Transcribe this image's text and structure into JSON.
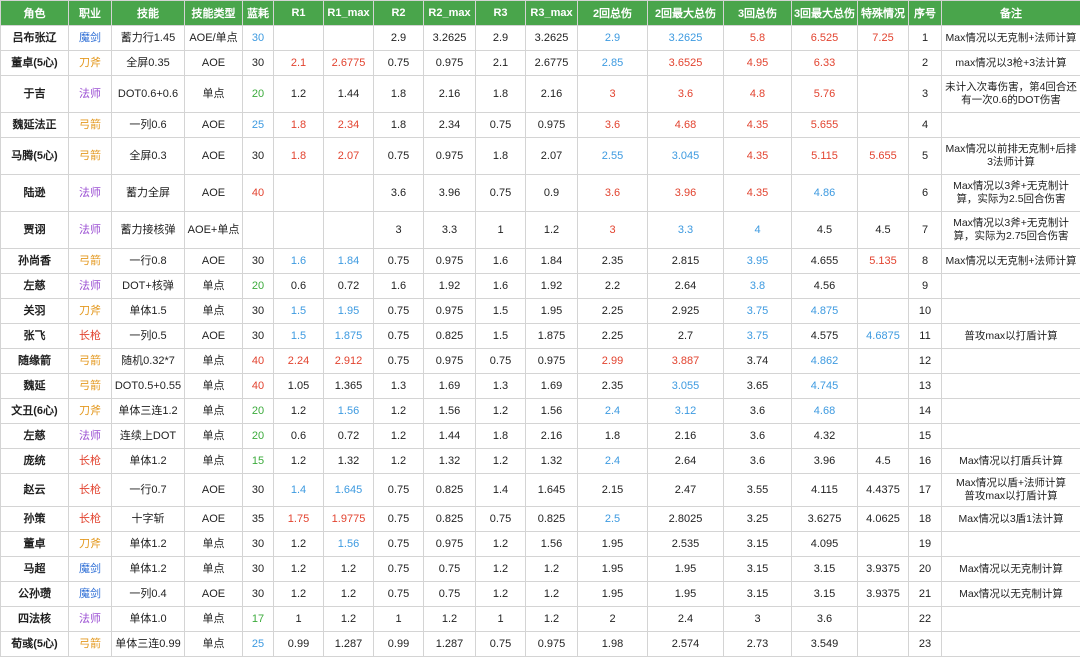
{
  "colors": {
    "header_bg": "#49a54b",
    "header_text": "#ffffff",
    "red": "#e2432f",
    "blue": "#3d9ae0",
    "green": "#3cab3c",
    "purple": "#9b4fd3",
    "orange": "#e49a22",
    "mo_jian": "#2f6fd6",
    "dao_fu": "#e49a22",
    "chang_qiang": "#e2432f"
  },
  "columns": [
    "角色",
    "职业",
    "技能",
    "技能类型",
    "蓝耗",
    "R1",
    "R1_max",
    "R2",
    "R2_max",
    "R3",
    "R3_max",
    "2回总伤",
    "2回最大总伤",
    "3回总伤",
    "3回最大总伤",
    "特殊情况",
    "序号",
    "备注"
  ],
  "rows": [
    {
      "name": "吕布张辽",
      "job": "魔剑",
      "skill": "蓄力行1.45",
      "type": "AOE/单点",
      "mana": "30",
      "manaColor": "blue",
      "r1": "",
      "r1c": "",
      "r1m": "",
      "r1mc": "",
      "r2": "2.9",
      "r2m": "3.2625",
      "r3": "2.9",
      "r3m": "3.2625",
      "t2": "2.9",
      "t2c": "blue",
      "t2m": "3.2625",
      "t2mc": "blue",
      "t3": "5.8",
      "t3c": "red",
      "t3m": "6.525",
      "t3mc": "red",
      "sp": "7.25",
      "spc": "red",
      "idx": "1",
      "note": "Max情况以无克制+法师计算"
    },
    {
      "name": "董卓(5心)",
      "job": "刀斧",
      "skill": "全屏0.35",
      "type": "AOE",
      "mana": "30",
      "manaColor": "",
      "r1": "2.1",
      "r1c": "red",
      "r1m": "2.6775",
      "r1mc": "red",
      "r2": "0.75",
      "r2m": "0.975",
      "r3": "2.1",
      "r3m": "2.6775",
      "t2": "2.85",
      "t2c": "blue",
      "t2m": "3.6525",
      "t2mc": "red",
      "t3": "4.95",
      "t3c": "red",
      "t3m": "6.33",
      "t3mc": "red",
      "sp": "",
      "spc": "",
      "idx": "2",
      "note": "max情况以3枪+3法计算"
    },
    {
      "name": "于吉",
      "job": "法师",
      "skill": "DOT0.6+0.6",
      "type": "单点",
      "mana": "20",
      "manaColor": "green",
      "r1": "1.2",
      "r1c": "",
      "r1m": "1.44",
      "r1mc": "",
      "r2": "1.8",
      "r2m": "2.16",
      "r3": "1.8",
      "r3m": "2.16",
      "t2": "3",
      "t2c": "red",
      "t2m": "3.6",
      "t2mc": "red",
      "t3": "4.8",
      "t3c": "red",
      "t3m": "5.76",
      "t3mc": "red",
      "sp": "",
      "spc": "",
      "idx": "3",
      "note": "未计入次毒伤害，第4回合还有一次0.6的DOT伤害"
    },
    {
      "name": "魏延法正",
      "job": "弓箭",
      "skill": "一列0.6",
      "type": "AOE",
      "mana": "25",
      "manaColor": "blue",
      "r1": "1.8",
      "r1c": "red",
      "r1m": "2.34",
      "r1mc": "red",
      "r2": "1.8",
      "r2m": "2.34",
      "r3": "0.75",
      "r3m": "0.975",
      "t2": "3.6",
      "t2c": "red",
      "t2m": "4.68",
      "t2mc": "red",
      "t3": "4.35",
      "t3c": "red",
      "t3m": "5.655",
      "t3mc": "red",
      "sp": "",
      "spc": "",
      "idx": "4",
      "note": ""
    },
    {
      "name": "马腾(5心)",
      "job": "弓箭",
      "skill": "全屏0.3",
      "type": "AOE",
      "mana": "30",
      "manaColor": "",
      "r1": "1.8",
      "r1c": "red",
      "r1m": "2.07",
      "r1mc": "red",
      "r2": "0.75",
      "r2m": "0.975",
      "r3": "1.8",
      "r3m": "2.07",
      "t2": "2.55",
      "t2c": "blue",
      "t2m": "3.045",
      "t2mc": "blue",
      "t3": "4.35",
      "t3c": "red",
      "t3m": "5.115",
      "t3mc": "red",
      "sp": "5.655",
      "spc": "red",
      "idx": "5",
      "note": "Max情况以前排无克制+后排3法师计算"
    },
    {
      "name": "陆逊",
      "job": "法师",
      "skill": "蓄力全屏",
      "type": "AOE",
      "mana": "40",
      "manaColor": "red",
      "r1": "",
      "r1c": "",
      "r1m": "",
      "r1mc": "",
      "r2": "3.6",
      "r2m": "3.96",
      "r3": "0.75",
      "r3m": "0.9",
      "t2": "3.6",
      "t2c": "red",
      "t2m": "3.96",
      "t2mc": "red",
      "t3": "4.35",
      "t3c": "red",
      "t3m": "4.86",
      "t3mc": "blue",
      "sp": "",
      "spc": "",
      "idx": "6",
      "note": "Max情况以3斧+无克制计算，实际为2.5回合伤害"
    },
    {
      "name": "贾诩",
      "job": "法师",
      "skill": "蓄力接核弹",
      "type": "AOE+单点",
      "mana": "",
      "manaColor": "",
      "r1": "",
      "r1c": "",
      "r1m": "",
      "r1mc": "",
      "r2": "3",
      "r2m": "3.3",
      "r3": "1",
      "r3m": "1.2",
      "t2": "3",
      "t2c": "red",
      "t2m": "3.3",
      "t2mc": "blue",
      "t3": "4",
      "t3c": "blue",
      "t3m": "4.5",
      "t3mc": "",
      "sp": "4.5",
      "spc": "",
      "idx": "7",
      "note": "Max情况以3斧+无克制计算，实际为2.75回合伤害"
    },
    {
      "name": "孙尚香",
      "job": "弓箭",
      "skill": "一行0.8",
      "type": "AOE",
      "mana": "30",
      "manaColor": "",
      "r1": "1.6",
      "r1c": "blue",
      "r1m": "1.84",
      "r1mc": "blue",
      "r2": "0.75",
      "r2m": "0.975",
      "r3": "1.6",
      "r3m": "1.84",
      "t2": "2.35",
      "t2c": "",
      "t2m": "2.815",
      "t2mc": "",
      "t3": "3.95",
      "t3c": "blue",
      "t3m": "4.655",
      "t3mc": "",
      "sp": "5.135",
      "spc": "red",
      "idx": "8",
      "note": "Max情况以无克制+法师计算"
    },
    {
      "name": "左慈",
      "job": "法师",
      "skill": "DOT+核弹",
      "type": "单点",
      "mana": "20",
      "manaColor": "green",
      "r1": "0.6",
      "r1c": "",
      "r1m": "0.72",
      "r1mc": "",
      "r2": "1.6",
      "r2m": "1.92",
      "r3": "1.6",
      "r3m": "1.92",
      "t2": "2.2",
      "t2c": "",
      "t2m": "2.64",
      "t2mc": "",
      "t3": "3.8",
      "t3c": "blue",
      "t3m": "4.56",
      "t3mc": "",
      "sp": "",
      "spc": "",
      "idx": "9",
      "note": ""
    },
    {
      "name": "关羽",
      "job": "刀斧",
      "skill": "单体1.5",
      "type": "单点",
      "mana": "30",
      "manaColor": "",
      "r1": "1.5",
      "r1c": "blue",
      "r1m": "1.95",
      "r1mc": "blue",
      "r2": "0.75",
      "r2m": "0.975",
      "r3": "1.5",
      "r3m": "1.95",
      "t2": "2.25",
      "t2c": "",
      "t2m": "2.925",
      "t2mc": "",
      "t3": "3.75",
      "t3c": "blue",
      "t3m": "4.875",
      "t3mc": "blue",
      "sp": "",
      "spc": "",
      "idx": "10",
      "note": ""
    },
    {
      "name": "张飞",
      "job": "长枪",
      "skill": "一列0.5",
      "type": "AOE",
      "mana": "30",
      "manaColor": "",
      "r1": "1.5",
      "r1c": "blue",
      "r1m": "1.875",
      "r1mc": "blue",
      "r2": "0.75",
      "r2m": "0.825",
      "r3": "1.5",
      "r3m": "1.875",
      "t2": "2.25",
      "t2c": "",
      "t2m": "2.7",
      "t2mc": "",
      "t3": "3.75",
      "t3c": "blue",
      "t3m": "4.575",
      "t3mc": "",
      "sp": "4.6875",
      "spc": "blue",
      "idx": "11",
      "note": "普攻max以打盾计算"
    },
    {
      "name": "随缘箭",
      "job": "弓箭",
      "skill": "随机0.32*7",
      "type": "单点",
      "mana": "40",
      "manaColor": "red",
      "r1": "2.24",
      "r1c": "red",
      "r1m": "2.912",
      "r1mc": "red",
      "r2": "0.75",
      "r2m": "0.975",
      "r3": "0.75",
      "r3m": "0.975",
      "t2": "2.99",
      "t2c": "red",
      "t2m": "3.887",
      "t2mc": "red",
      "t3": "3.74",
      "t3c": "",
      "t3m": "4.862",
      "t3mc": "blue",
      "sp": "",
      "spc": "",
      "idx": "12",
      "note": ""
    },
    {
      "name": "魏延",
      "job": "弓箭",
      "skill": "DOT0.5+0.55",
      "type": "单点",
      "mana": "40",
      "manaColor": "red",
      "r1": "1.05",
      "r1c": "",
      "r1m": "1.365",
      "r1mc": "",
      "r2": "1.3",
      "r2m": "1.69",
      "r3": "1.3",
      "r3m": "1.69",
      "t2": "2.35",
      "t2c": "",
      "t2m": "3.055",
      "t2mc": "blue",
      "t3": "3.65",
      "t3c": "",
      "t3m": "4.745",
      "t3mc": "blue",
      "sp": "",
      "spc": "",
      "idx": "13",
      "note": ""
    },
    {
      "name": "文丑(6心)",
      "job": "刀斧",
      "skill": "单体三连1.2",
      "type": "单点",
      "mana": "20",
      "manaColor": "green",
      "r1": "1.2",
      "r1c": "",
      "r1m": "1.56",
      "r1mc": "blue",
      "r2": "1.2",
      "r2m": "1.56",
      "r3": "1.2",
      "r3m": "1.56",
      "t2": "2.4",
      "t2c": "blue",
      "t2m": "3.12",
      "t2mc": "blue",
      "t3": "3.6",
      "t3c": "",
      "t3m": "4.68",
      "t3mc": "blue",
      "sp": "",
      "spc": "",
      "idx": "14",
      "note": ""
    },
    {
      "name": "左慈",
      "job": "法师",
      "skill": "连续上DOT",
      "type": "单点",
      "mana": "20",
      "manaColor": "green",
      "r1": "0.6",
      "r1c": "",
      "r1m": "0.72",
      "r1mc": "",
      "r2": "1.2",
      "r2m": "1.44",
      "r3": "1.8",
      "r3m": "2.16",
      "t2": "1.8",
      "t2c": "",
      "t2m": "2.16",
      "t2mc": "",
      "t3": "3.6",
      "t3c": "",
      "t3m": "4.32",
      "t3mc": "",
      "sp": "",
      "spc": "",
      "idx": "15",
      "note": ""
    },
    {
      "name": "庞统",
      "job": "长枪",
      "skill": "单体1.2",
      "type": "单点",
      "mana": "15",
      "manaColor": "green",
      "r1": "1.2",
      "r1c": "",
      "r1m": "1.32",
      "r1mc": "",
      "r2": "1.2",
      "r2m": "1.32",
      "r3": "1.2",
      "r3m": "1.32",
      "t2": "2.4",
      "t2c": "blue",
      "t2m": "2.64",
      "t2mc": "",
      "t3": "3.6",
      "t3c": "",
      "t3m": "3.96",
      "t3mc": "",
      "sp": "4.5",
      "spc": "",
      "idx": "16",
      "note": "Max情况以打盾兵计算"
    },
    {
      "name": "赵云",
      "job": "长枪",
      "skill": "一行0.7",
      "type": "AOE",
      "mana": "30",
      "manaColor": "",
      "r1": "1.4",
      "r1c": "blue",
      "r1m": "1.645",
      "r1mc": "blue",
      "r2": "0.75",
      "r2m": "0.825",
      "r3": "1.4",
      "r3m": "1.645",
      "t2": "2.15",
      "t2c": "",
      "t2m": "2.47",
      "t2mc": "",
      "t3": "3.55",
      "t3c": "",
      "t3m": "4.115",
      "t3mc": "",
      "sp": "4.4375",
      "spc": "",
      "idx": "17",
      "note": "Max情况以盾+法师计算\n普攻max以打盾计算"
    },
    {
      "name": "孙策",
      "job": "长枪",
      "skill": "十字斩",
      "type": "AOE",
      "mana": "35",
      "manaColor": "",
      "r1": "1.75",
      "r1c": "red",
      "r1m": "1.9775",
      "r1mc": "red",
      "r2": "0.75",
      "r2m": "0.825",
      "r3": "0.75",
      "r3m": "0.825",
      "t2": "2.5",
      "t2c": "blue",
      "t2m": "2.8025",
      "t2mc": "",
      "t3": "3.25",
      "t3c": "",
      "t3m": "3.6275",
      "t3mc": "",
      "sp": "4.0625",
      "spc": "",
      "idx": "18",
      "note": "Max情况以3盾1法计算"
    },
    {
      "name": "董卓",
      "job": "刀斧",
      "skill": "单体1.2",
      "type": "单点",
      "mana": "30",
      "manaColor": "",
      "r1": "1.2",
      "r1c": "",
      "r1m": "1.56",
      "r1mc": "blue",
      "r2": "0.75",
      "r2m": "0.975",
      "r3": "1.2",
      "r3m": "1.56",
      "t2": "1.95",
      "t2c": "",
      "t2m": "2.535",
      "t2mc": "",
      "t3": "3.15",
      "t3c": "",
      "t3m": "4.095",
      "t3mc": "",
      "sp": "",
      "spc": "",
      "idx": "19",
      "note": ""
    },
    {
      "name": "马超",
      "job": "魔剑",
      "skill": "单体1.2",
      "type": "单点",
      "mana": "30",
      "manaColor": "",
      "r1": "1.2",
      "r1c": "",
      "r1m": "1.2",
      "r1mc": "",
      "r2": "0.75",
      "r2m": "0.75",
      "r3": "1.2",
      "r3m": "1.2",
      "t2": "1.95",
      "t2c": "",
      "t2m": "1.95",
      "t2mc": "",
      "t3": "3.15",
      "t3c": "",
      "t3m": "3.15",
      "t3mc": "",
      "sp": "3.9375",
      "spc": "",
      "idx": "20",
      "note": "Max情况以无克制计算"
    },
    {
      "name": "公孙瓒",
      "job": "魔剑",
      "skill": "一列0.4",
      "type": "AOE",
      "mana": "30",
      "manaColor": "",
      "r1": "1.2",
      "r1c": "",
      "r1m": "1.2",
      "r1mc": "",
      "r2": "0.75",
      "r2m": "0.75",
      "r3": "1.2",
      "r3m": "1.2",
      "t2": "1.95",
      "t2c": "",
      "t2m": "1.95",
      "t2mc": "",
      "t3": "3.15",
      "t3c": "",
      "t3m": "3.15",
      "t3mc": "",
      "sp": "3.9375",
      "spc": "",
      "idx": "21",
      "note": "Max情况以无克制计算"
    },
    {
      "name": "四法核",
      "job": "法师",
      "skill": "单体1.0",
      "type": "单点",
      "mana": "17",
      "manaColor": "green",
      "r1": "1",
      "r1c": "",
      "r1m": "1.2",
      "r1mc": "",
      "r2": "1",
      "r2m": "1.2",
      "r3": "1",
      "r3m": "1.2",
      "t2": "2",
      "t2c": "",
      "t2m": "2.4",
      "t2mc": "",
      "t3": "3",
      "t3c": "",
      "t3m": "3.6",
      "t3mc": "",
      "sp": "",
      "spc": "",
      "idx": "22",
      "note": ""
    },
    {
      "name": "荀彧(5心)",
      "job": "弓箭",
      "skill": "单体三连0.99",
      "type": "单点",
      "mana": "25",
      "manaColor": "blue",
      "r1": "0.99",
      "r1c": "",
      "r1m": "1.287",
      "r1mc": "",
      "r2": "0.99",
      "r2m": "1.287",
      "r3": "0.75",
      "r3m": "0.975",
      "t2": "1.98",
      "t2c": "",
      "t2m": "2.574",
      "t2mc": "",
      "t3": "2.73",
      "t3c": "",
      "t3m": "3.549",
      "t3mc": "",
      "sp": "",
      "spc": "",
      "idx": "23",
      "note": ""
    }
  ]
}
